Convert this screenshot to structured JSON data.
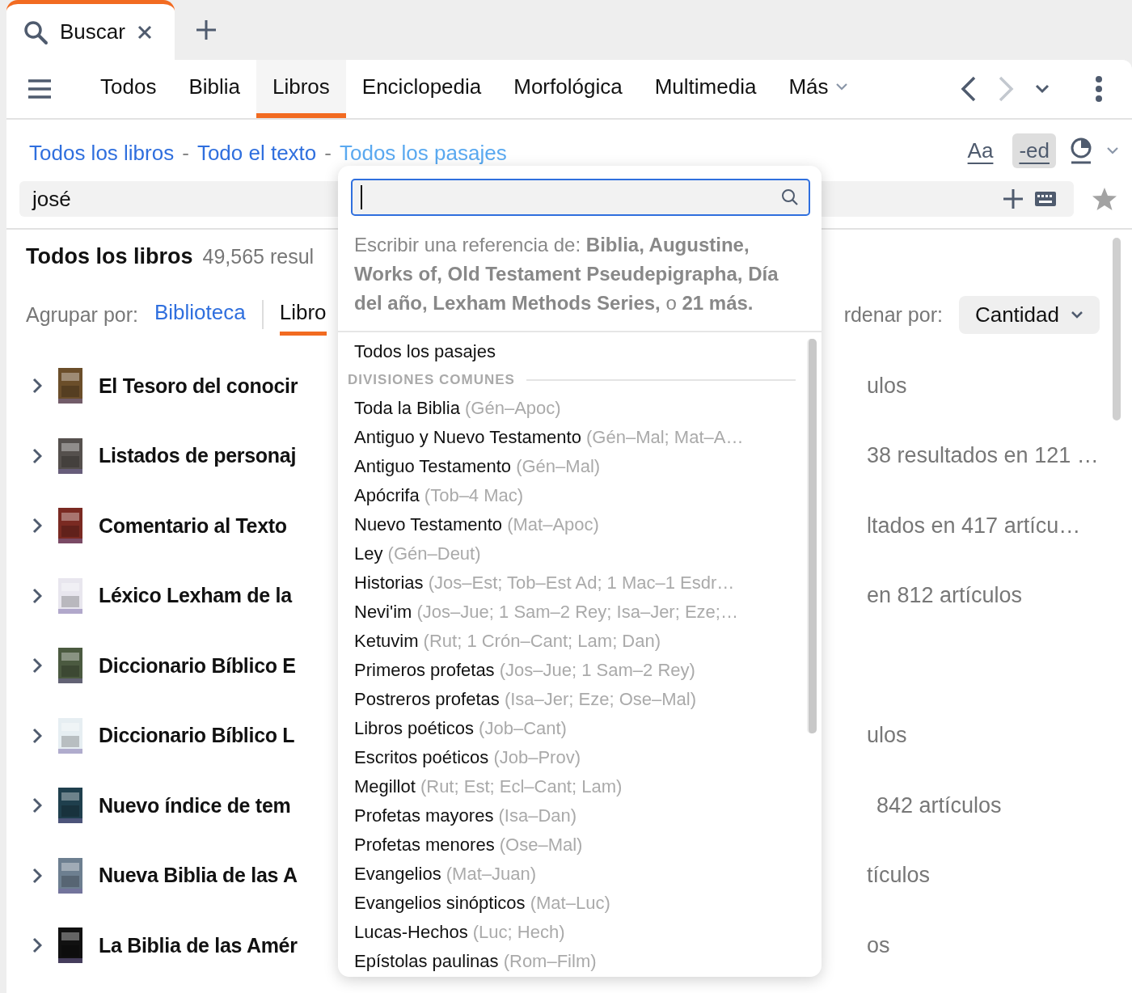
{
  "window_tabs": [
    {
      "label": "Buscar",
      "selected": true
    }
  ],
  "nav_tabs": [
    {
      "label": "Todos",
      "selected": false
    },
    {
      "label": "Biblia",
      "selected": false
    },
    {
      "label": "Libros",
      "selected": true
    },
    {
      "label": "Enciclopedia",
      "selected": false
    },
    {
      "label": "Morfológica",
      "selected": false
    },
    {
      "label": "Multimedia",
      "selected": false
    }
  ],
  "more_menu": "Más",
  "breadcrumb": [
    "Todos los libros",
    "Todo el texto",
    "Todos los pasajes"
  ],
  "breadcrumb_separator": "-",
  "view_options": [
    {
      "label": "Aa",
      "selected": false
    },
    {
      "label": "-ed",
      "selected": true
    }
  ],
  "search": {
    "value": "josé"
  },
  "results": {
    "title": "Todos los libros",
    "count": "49,565 resul"
  },
  "group_by": {
    "label": "Agrupar por:",
    "options": [
      {
        "label": "Biblioteca",
        "selected": false
      },
      {
        "label": "Libro",
        "selected": true
      }
    ]
  },
  "sort_by": {
    "label": "rdenar por:",
    "value": "Cantidad"
  },
  "books": [
    {
      "title": "El Tesoro del conocir",
      "summary": "ulos"
    },
    {
      "title": "Listados de personaj",
      "summary": "38 resultados en 121 …"
    },
    {
      "title": "Comentario al Texto",
      "summary": "ltados en 417 artícu…"
    },
    {
      "title": "Léxico Lexham de la",
      "summary": "en 812 artículos"
    },
    {
      "title": "Diccionario Bíblico E"
    },
    {
      "title": "Diccionario Bíblico L",
      "summary": "ulos"
    },
    {
      "title": "Nuevo índice de tem",
      "summary": "842 artículos"
    },
    {
      "title": "Nueva Biblia de las A",
      "summary": "tículos"
    },
    {
      "title": "La Biblia de las Amér",
      "summary": "os"
    }
  ],
  "passage_picker": {
    "hint": "Escribir una referencia de: **Biblia, Augustine, Works of, Old Testament Pseudepigrapha, Día del año, Lexham Methods Series,** o **21 más.**",
    "first_item": "Todos los pasajes",
    "section": "DIVISIONES COMUNES",
    "items": [
      {
        "name": "Toda la Biblia",
        "range": "(Gén–Apoc)"
      },
      {
        "name": "Antiguo y Nuevo Testamento",
        "range": "(Gén–Mal; Mat–A…"
      },
      {
        "name": "Antiguo Testamento",
        "range": "(Gén–Mal)"
      },
      {
        "name": "Apócrifa",
        "range": "(Tob–4 Mac)"
      },
      {
        "name": "Nuevo Testamento",
        "range": "(Mat–Apoc)"
      },
      {
        "name": "Ley",
        "range": "(Gén–Deut)"
      },
      {
        "name": "Historias",
        "range": "(Jos–Est; Tob–Est Ad; 1 Mac–1 Esdr…"
      },
      {
        "name": "Nevi'im",
        "range": "(Jos–Jue; 1 Sam–2 Rey; Isa–Jer; Eze;…"
      },
      {
        "name": "Ketuvim",
        "range": "(Rut; 1 Crón–Cant; Lam; Dan)"
      },
      {
        "name": "Primeros profetas",
        "range": "(Jos–Jue; 1 Sam–2 Rey)"
      },
      {
        "name": "Postreros profetas",
        "range": "(Isa–Jer; Eze; Ose–Mal)"
      },
      {
        "name": "Libros poéticos",
        "range": "(Job–Cant)"
      },
      {
        "name": "Escritos poéticos",
        "range": "(Job–Prov)"
      },
      {
        "name": "Megillot",
        "range": "(Rut; Est; Ecl–Cant; Lam)"
      },
      {
        "name": "Profetas mayores",
        "range": "(Isa–Dan)"
      },
      {
        "name": "Profetas menores",
        "range": "(Ose–Mal)"
      },
      {
        "name": "Evangelios",
        "range": "(Mat–Juan)"
      },
      {
        "name": "Evangelios sinópticos",
        "range": "(Mat–Luc)"
      },
      {
        "name": "Lucas-Hechos",
        "range": "(Luc; Hech)"
      },
      {
        "name": "Epístolas paulinas",
        "range": "(Rom–Film)"
      }
    ]
  }
}
